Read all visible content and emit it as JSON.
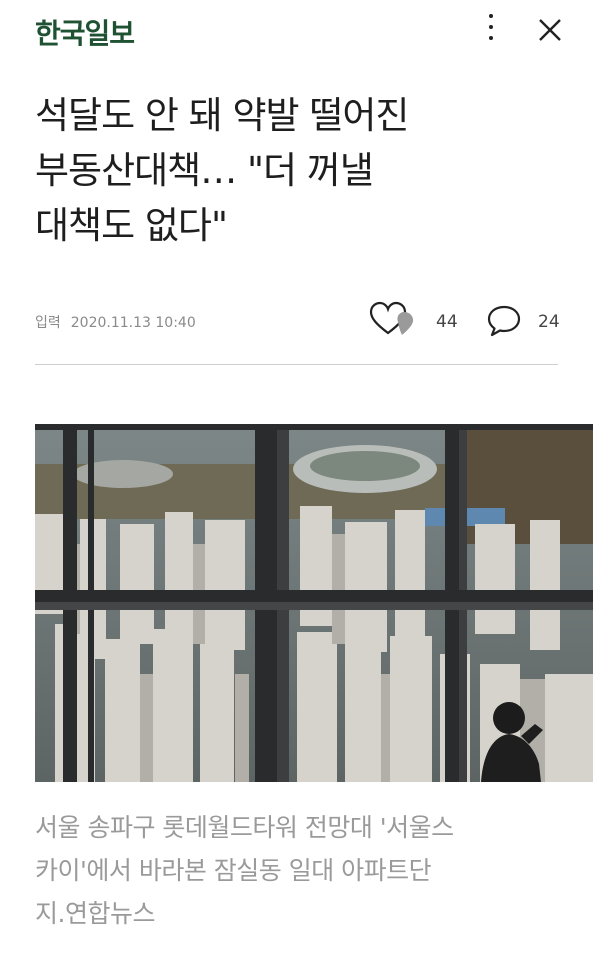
{
  "header": {
    "logo": "한국일보",
    "more_icon": "vertical-dots-icon",
    "close_icon": "close-icon"
  },
  "article": {
    "title_lines": [
      "석달도 안 돼 약발 떨어진",
      "부동산대책… \"더 꺼낼",
      "대책도 없다\""
    ],
    "meta_label": "입력",
    "published": "2020.11.13 10:40",
    "likes": "44",
    "comments": "24",
    "caption_lines": [
      "서울 송파구 롯데월드타워 전망대 '서울스",
      "카이'에서 바라본 잠실동 일대 아파트단",
      "지.연합뉴스"
    ]
  },
  "colors": {
    "logo": "#1f5233",
    "caption": "#9a9a9a",
    "meta": "#8a8a8a"
  }
}
